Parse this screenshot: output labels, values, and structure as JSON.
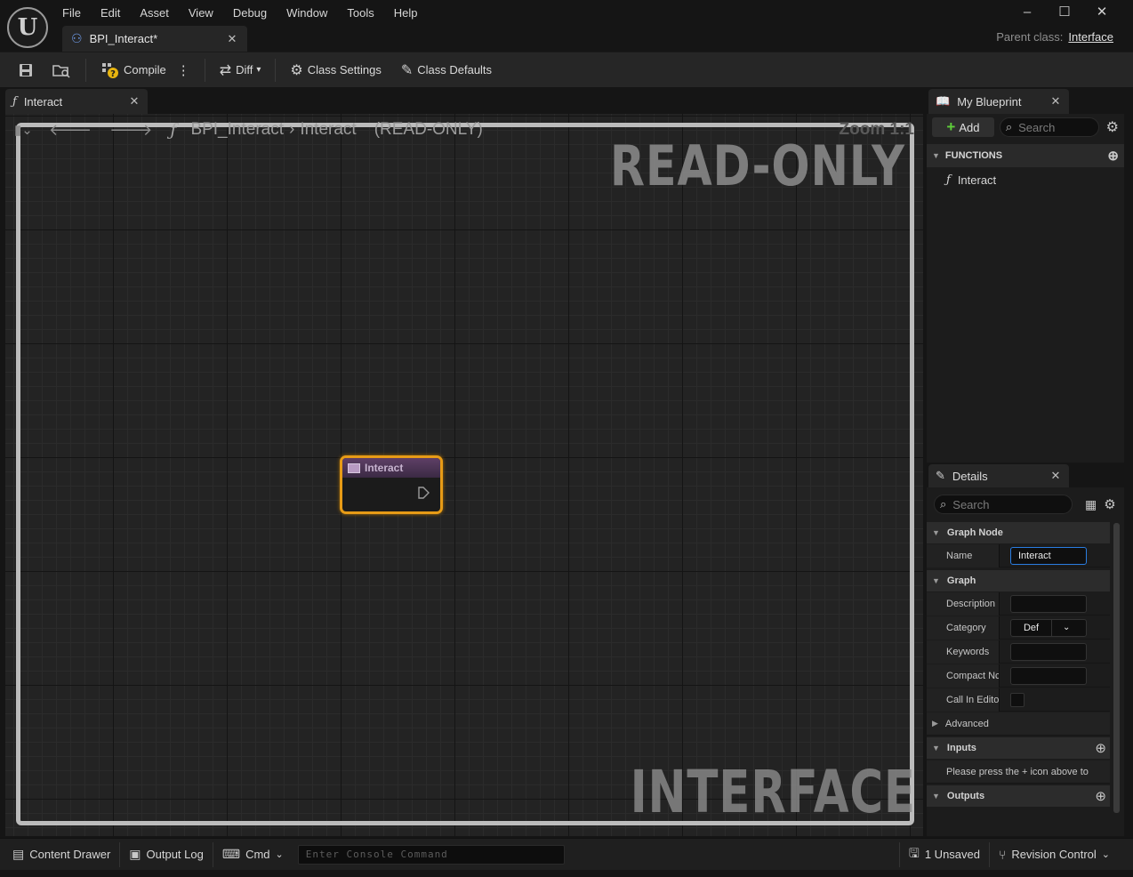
{
  "app": {
    "logo_glyph": "U",
    "menu": [
      "File",
      "Edit",
      "Asset",
      "View",
      "Debug",
      "Window",
      "Tools",
      "Help"
    ],
    "document_tab": "BPI_Interact*",
    "window_controls": {
      "minimize": "–",
      "maximize": "☐",
      "close": "✕"
    },
    "parent_class_label": "Parent class:",
    "parent_class_value": "Interface"
  },
  "toolbar": {
    "compile_label": "Compile",
    "diff_label": "Diff",
    "class_settings_label": "Class Settings",
    "class_defaults_label": "Class Defaults"
  },
  "graph": {
    "tab_label": "Interact",
    "breadcrumb_asset": "BPI_Interact",
    "breadcrumb_function": "Interact",
    "breadcrumb_state": "(READ-ONLY)",
    "zoom_text": "Zoom 1:1",
    "watermark_top": "READ-ONLY",
    "watermark_bottom": "INTERFACE",
    "node_title": "Interact",
    "node_color": "#e79b16"
  },
  "my_blueprint": {
    "tab_label": "My Blueprint",
    "add_label": "Add",
    "search_placeholder": "Search",
    "functions_header": "FUNCTIONS",
    "functions": [
      "Interact"
    ]
  },
  "details": {
    "tab_label": "Details",
    "search_placeholder": "Search",
    "graph_node_header": "Graph Node",
    "name_label": "Name",
    "name_value": "Interact",
    "graph_header": "Graph",
    "description_label": "Description",
    "category_label": "Category",
    "category_value": "Def",
    "keywords_label": "Keywords",
    "compact_label": "Compact Nc",
    "call_in_editor_label": "Call In Edito",
    "advanced_label": "Advanced",
    "inputs_header": "Inputs",
    "inputs_hint": "Please press the + icon above to",
    "outputs_header": "Outputs"
  },
  "statusbar": {
    "content_drawer": "Content Drawer",
    "output_log": "Output Log",
    "cmd": "Cmd",
    "console_placeholder": "Enter Console Command",
    "unsaved": "1 Unsaved",
    "revision_control": "Revision Control"
  }
}
